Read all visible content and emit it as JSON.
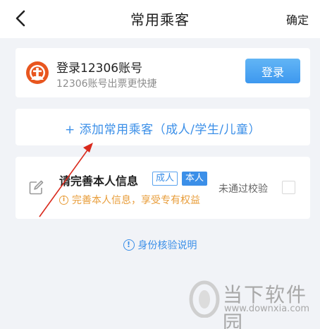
{
  "header": {
    "title": "常用乘客",
    "confirm_label": "确定",
    "back_icon": "chevron-left-icon"
  },
  "login_card": {
    "title": "登录12306账号",
    "subtitle": "12306账号出票更快捷",
    "button_label": "登录",
    "logo_icon": "railway-logo-icon",
    "logo_color": "#e8561f",
    "button_color": "#4aa3f0"
  },
  "add_passenger": {
    "label": "+ 添加常用乘客（成人/学生/儿童）"
  },
  "passenger_info": {
    "title": "请完善本人信息",
    "tag_adult": "成人",
    "tag_self": "本人",
    "status": "未通过校验",
    "warning": "完善本人信息，享受专有权益",
    "warning_color": "#e89d3a"
  },
  "verify_link": {
    "label": "身份核验说明",
    "icon": "info-circle-icon"
  },
  "watermark": {
    "name": "当下软件园",
    "url": "www.downxia.com"
  },
  "annotation": {
    "color": "#d9291c"
  }
}
